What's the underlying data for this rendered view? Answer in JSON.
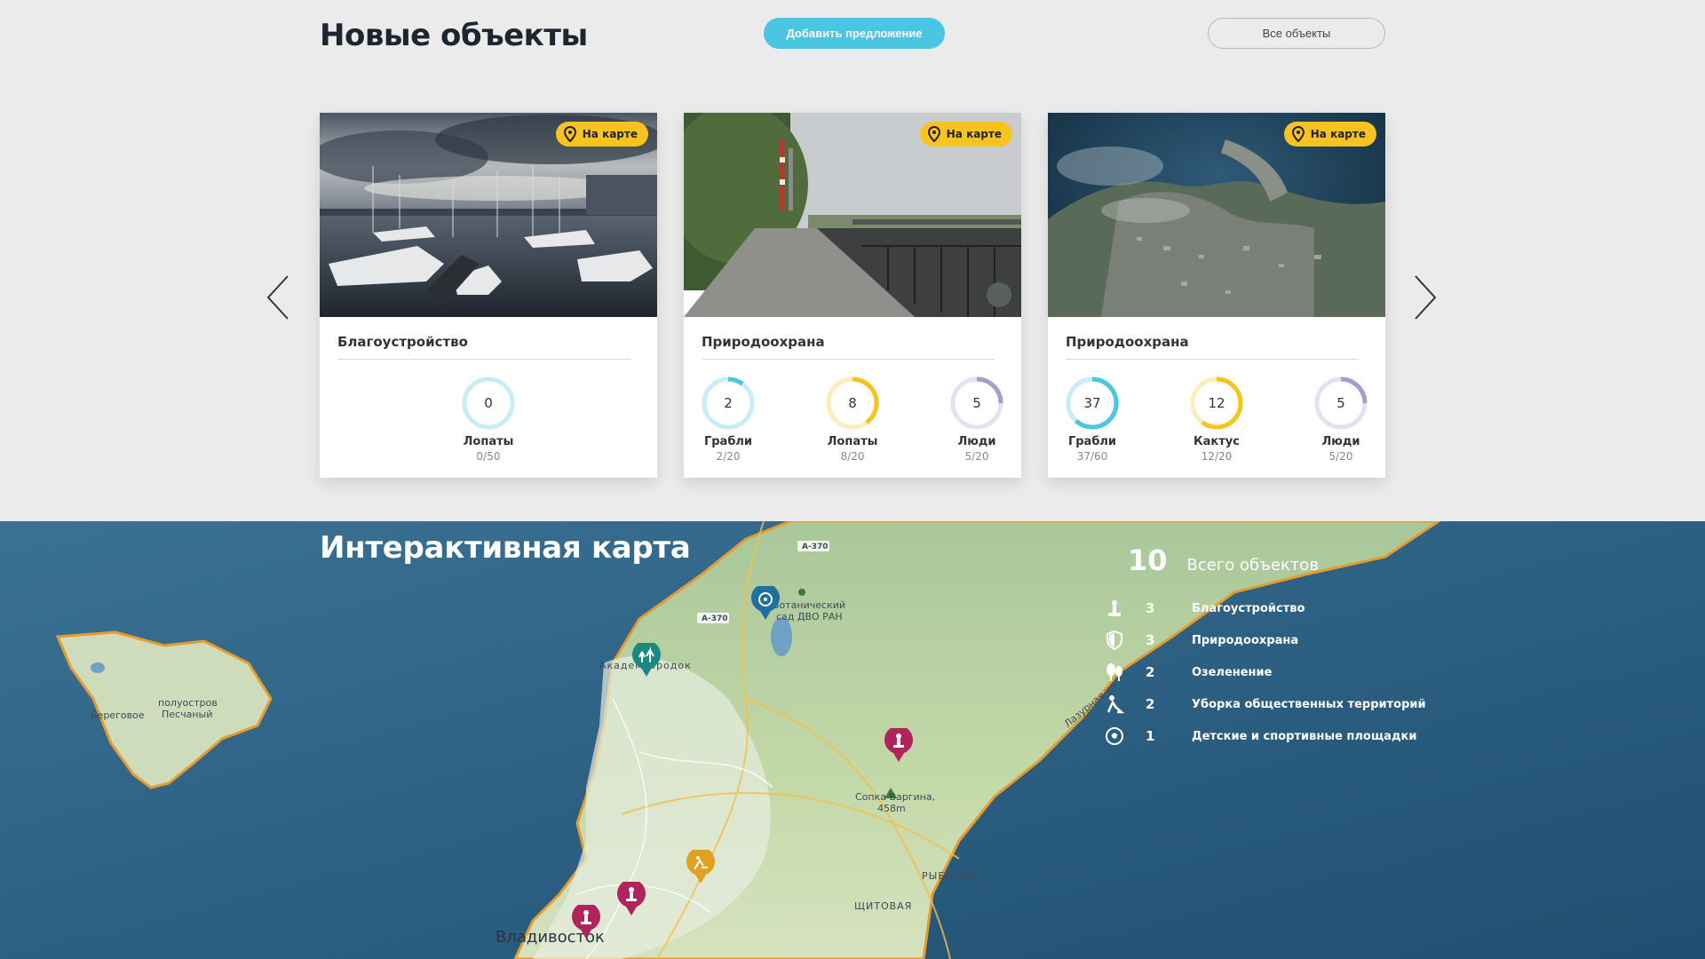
{
  "header": {
    "title": "Новые объекты",
    "add_label": "Добавить предложение",
    "all_label": "Все объекты"
  },
  "cards": [
    {
      "badge": "На карте",
      "category": "Благоустройство",
      "stats": [
        {
          "value": "0",
          "label": "Лопаты",
          "sub": "0/50",
          "fraction": 0.0,
          "color": "#4ac5e2"
        }
      ]
    },
    {
      "badge": "На карте",
      "category": "Природоохрана",
      "stats": [
        {
          "value": "2",
          "label": "Грабли",
          "sub": "2/20",
          "fraction": 0.1,
          "color": "#4ac5e2"
        },
        {
          "value": "8",
          "label": "Лопаты",
          "sub": "8/20",
          "fraction": 0.4,
          "color": "#f7c31f"
        },
        {
          "value": "5",
          "label": "Люди",
          "sub": "5/20",
          "fraction": 0.25,
          "color": "#a89bd0"
        }
      ]
    },
    {
      "badge": "На карте",
      "category": "Природоохрана",
      "stats": [
        {
          "value": "37",
          "label": "Грабли",
          "sub": "37/60",
          "fraction": 0.617,
          "color": "#4ac5e2"
        },
        {
          "value": "12",
          "label": "Кактус",
          "sub": "12/20",
          "fraction": 0.6,
          "color": "#f7c31f"
        },
        {
          "value": "5",
          "label": "Люди",
          "sub": "5/20",
          "fraction": 0.25,
          "color": "#a89bd0"
        }
      ]
    }
  ],
  "map": {
    "title": "Интерактивная карта",
    "total_count": "10",
    "total_label": "Всего объектов",
    "legend": [
      {
        "icon": "monument-icon",
        "count": "3",
        "name": "Благоустройство"
      },
      {
        "icon": "shield-icon",
        "count": "3",
        "name": "Природоохрана"
      },
      {
        "icon": "trees-icon",
        "count": "2",
        "name": "Озеленение"
      },
      {
        "icon": "cleaning-icon",
        "count": "2",
        "name": "Уборка общественных территорий"
      },
      {
        "icon": "ball-icon",
        "count": "1",
        "name": "Детские и спортивные площадки"
      }
    ],
    "labels": {
      "city": "Владивосток",
      "garden": "Ботанический сад ДВО РАН",
      "garden_line1": "Ботанический",
      "garden_line2": "сад ДВО РАН",
      "peninsula_line1": "полуостров",
      "peninsula_line2": "Песчаный",
      "beregovoe": "Береговое",
      "gorodok": "Академгородок",
      "hill_line1": "Сопка Варгина,",
      "hill_line2": "458m",
      "shchitovaya": "ЩИТОВАЯ",
      "rybachiy": "РЫБАЧИЙ",
      "road1": "А-370",
      "road2": "А-370",
      "lazurnaya": "Лазурная ул."
    }
  },
  "colors": {
    "accent_blue": "#4ac5e2",
    "accent_yellow": "#f7c31f",
    "accent_purple": "#a89bd0",
    "pin_magenta": "#b0245e",
    "pin_teal": "#1a8a80",
    "pin_blue": "#1f6fa0",
    "pin_orange": "#e0a020"
  }
}
